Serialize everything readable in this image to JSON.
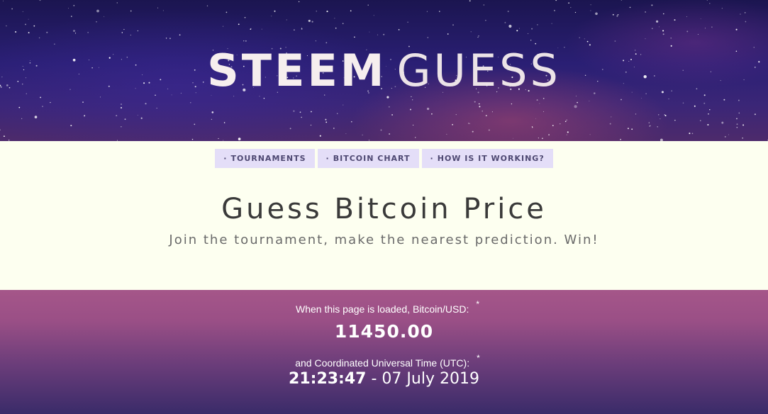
{
  "hero": {
    "title_bold": "STEEM",
    "title_light": "GUESS"
  },
  "nav": {
    "items": [
      {
        "label": "TOURNAMENTS"
      },
      {
        "label": "BITCOIN CHART"
      },
      {
        "label": "HOW IS IT WORKING?"
      }
    ],
    "bullet": "·"
  },
  "headline": "Guess Bitcoin Price",
  "subline": "Join the tournament, make the nearest prediction. Win!",
  "price": {
    "label": "When this page is loaded, Bitcoin/USD:",
    "value": "11450.00",
    "asterisk": "*"
  },
  "time": {
    "label": "and Coordinated Universal Time (UTC):",
    "clock": "21:23:47",
    "separator": " - ",
    "date": "07 July 2019",
    "asterisk": "*"
  },
  "colors": {
    "page_bg": "#fdfff0",
    "nav_bg": "#e4def8",
    "panel_top": "#a55689",
    "panel_bottom": "#3a2b69"
  }
}
